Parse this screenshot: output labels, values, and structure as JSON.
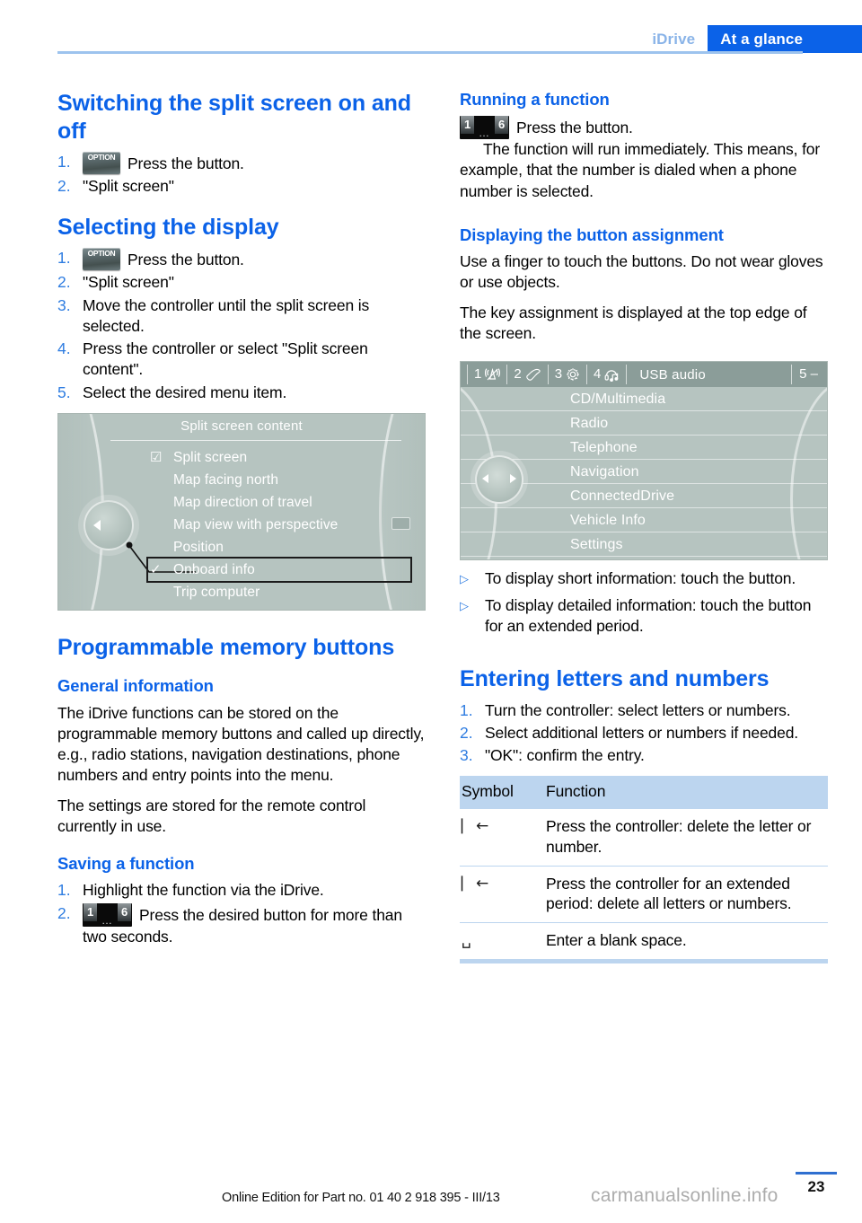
{
  "header": {
    "chapter": "iDrive",
    "section": "At a glance"
  },
  "left_column": {
    "h1_switching": "Switching the split screen on and off",
    "switching_steps": [
      {
        "num": "1.",
        "icon": "option-button-icon",
        "text": "Press the button."
      },
      {
        "num": "2.",
        "icon": "",
        "text": "\"Split screen\""
      }
    ],
    "h1_selecting": "Selecting the display",
    "selecting_steps": [
      {
        "num": "1.",
        "icon": "option-button-icon",
        "text": "Press the button."
      },
      {
        "num": "2.",
        "icon": "",
        "text": "\"Split screen\""
      },
      {
        "num": "3.",
        "icon": "",
        "text": "Move the controller until the split screen is selected."
      },
      {
        "num": "4.",
        "icon": "",
        "text": "Press the controller or select \"Split screen content\"."
      },
      {
        "num": "5.",
        "icon": "",
        "text": "Select the desired menu item."
      }
    ],
    "split_screen_figure": {
      "title": "Split screen content",
      "items": [
        {
          "label": "Split screen",
          "mark": "checkbox-checked-icon",
          "selected": false
        },
        {
          "label": "Map facing north",
          "mark": "",
          "selected": false
        },
        {
          "label": "Map direction of travel",
          "mark": "",
          "selected": false
        },
        {
          "label": "Map view with perspective",
          "mark": "",
          "selected": false
        },
        {
          "label": "Position",
          "mark": "",
          "selected": false
        },
        {
          "label": "Onboard info",
          "mark": "check-icon",
          "selected": true
        },
        {
          "label": "Trip computer",
          "mark": "",
          "selected": false
        }
      ]
    },
    "h1_memory": "Programmable memory buttons",
    "h2_general": "General information",
    "general_p1": "The iDrive functions can be stored on the programmable memory buttons and called up directly, e.g., radio stations, navigation destinations, phone numbers and entry points into the menu.",
    "general_p2": "The settings are stored for the remote control currently in use.",
    "h2_saving": "Saving a function",
    "saving_steps": [
      {
        "num": "1.",
        "icon": "",
        "text": "Highlight the function via the iDrive."
      },
      {
        "num": "2.",
        "icon": "memory-button-icon",
        "text": "Press the desired button for more than two seconds."
      }
    ]
  },
  "right_column": {
    "h2_running": "Running a function",
    "running_icon": "memory-button-icon",
    "running_line1": "Press the button.",
    "running_p": "The function will run immediately. This means, for example, that the number is dialed when a phone number is selected.",
    "h2_displaying": "Displaying the button assignment",
    "displaying_p1": "Use a finger to touch the buttons. Do not wear gloves or use objects.",
    "displaying_p2": "The key assignment is displayed at the top edge of the screen.",
    "usb_figure": {
      "slots": [
        {
          "num": "1",
          "icon": "radio-antenna-muted-icon"
        },
        {
          "num": "2",
          "icon": "phone-handset-icon"
        },
        {
          "num": "3",
          "icon": "gear-icon"
        },
        {
          "num": "4",
          "icon": "music-note-icon"
        }
      ],
      "label": "USB audio",
      "right_slot": "5 –",
      "items": [
        "CD/Multimedia",
        "Radio",
        "Telephone",
        "Navigation",
        "ConnectedDrive",
        "Vehicle Info",
        "Settings"
      ]
    },
    "arrows": [
      {
        "mark": "▷",
        "text": "To display short information: touch the button."
      },
      {
        "mark": "▷",
        "text": "To display detailed information: touch the button for an extended period."
      }
    ],
    "h1_entering": "Entering letters and numbers",
    "entering_steps": [
      {
        "num": "1.",
        "text": "Turn the controller: select letters or numbers."
      },
      {
        "num": "2.",
        "text": "Select additional letters or numbers if needed."
      },
      {
        "num": "3.",
        "text": "\"OK\": confirm the entry."
      }
    ],
    "symbol_table": {
      "headers": [
        "Symbol",
        "Function"
      ],
      "rows": [
        {
          "symbol": "⎸←",
          "symbol_name": "delete-character-icon",
          "function": "Press the controller: delete the letter or number."
        },
        {
          "symbol": "⎸←",
          "symbol_name": "delete-all-icon",
          "function": "Press the controller for an extended period: delete all letters or numbers."
        },
        {
          "symbol": "␣",
          "symbol_name": "blank-space-icon",
          "function": "Enter a blank space."
        }
      ]
    }
  },
  "footer": {
    "edition_text": "Online Edition for Part no. 01 40 2 918 395 - III/13",
    "page_number": "23",
    "watermark": "carmanualsonline.info"
  },
  "colors": {
    "accent_blue": "#0b62e8",
    "light_blue": "#8ab4e8",
    "rule_blue": "#9dc3ee",
    "table_header": "#bcd5ef",
    "screen_bg": "#b6c4c0"
  }
}
